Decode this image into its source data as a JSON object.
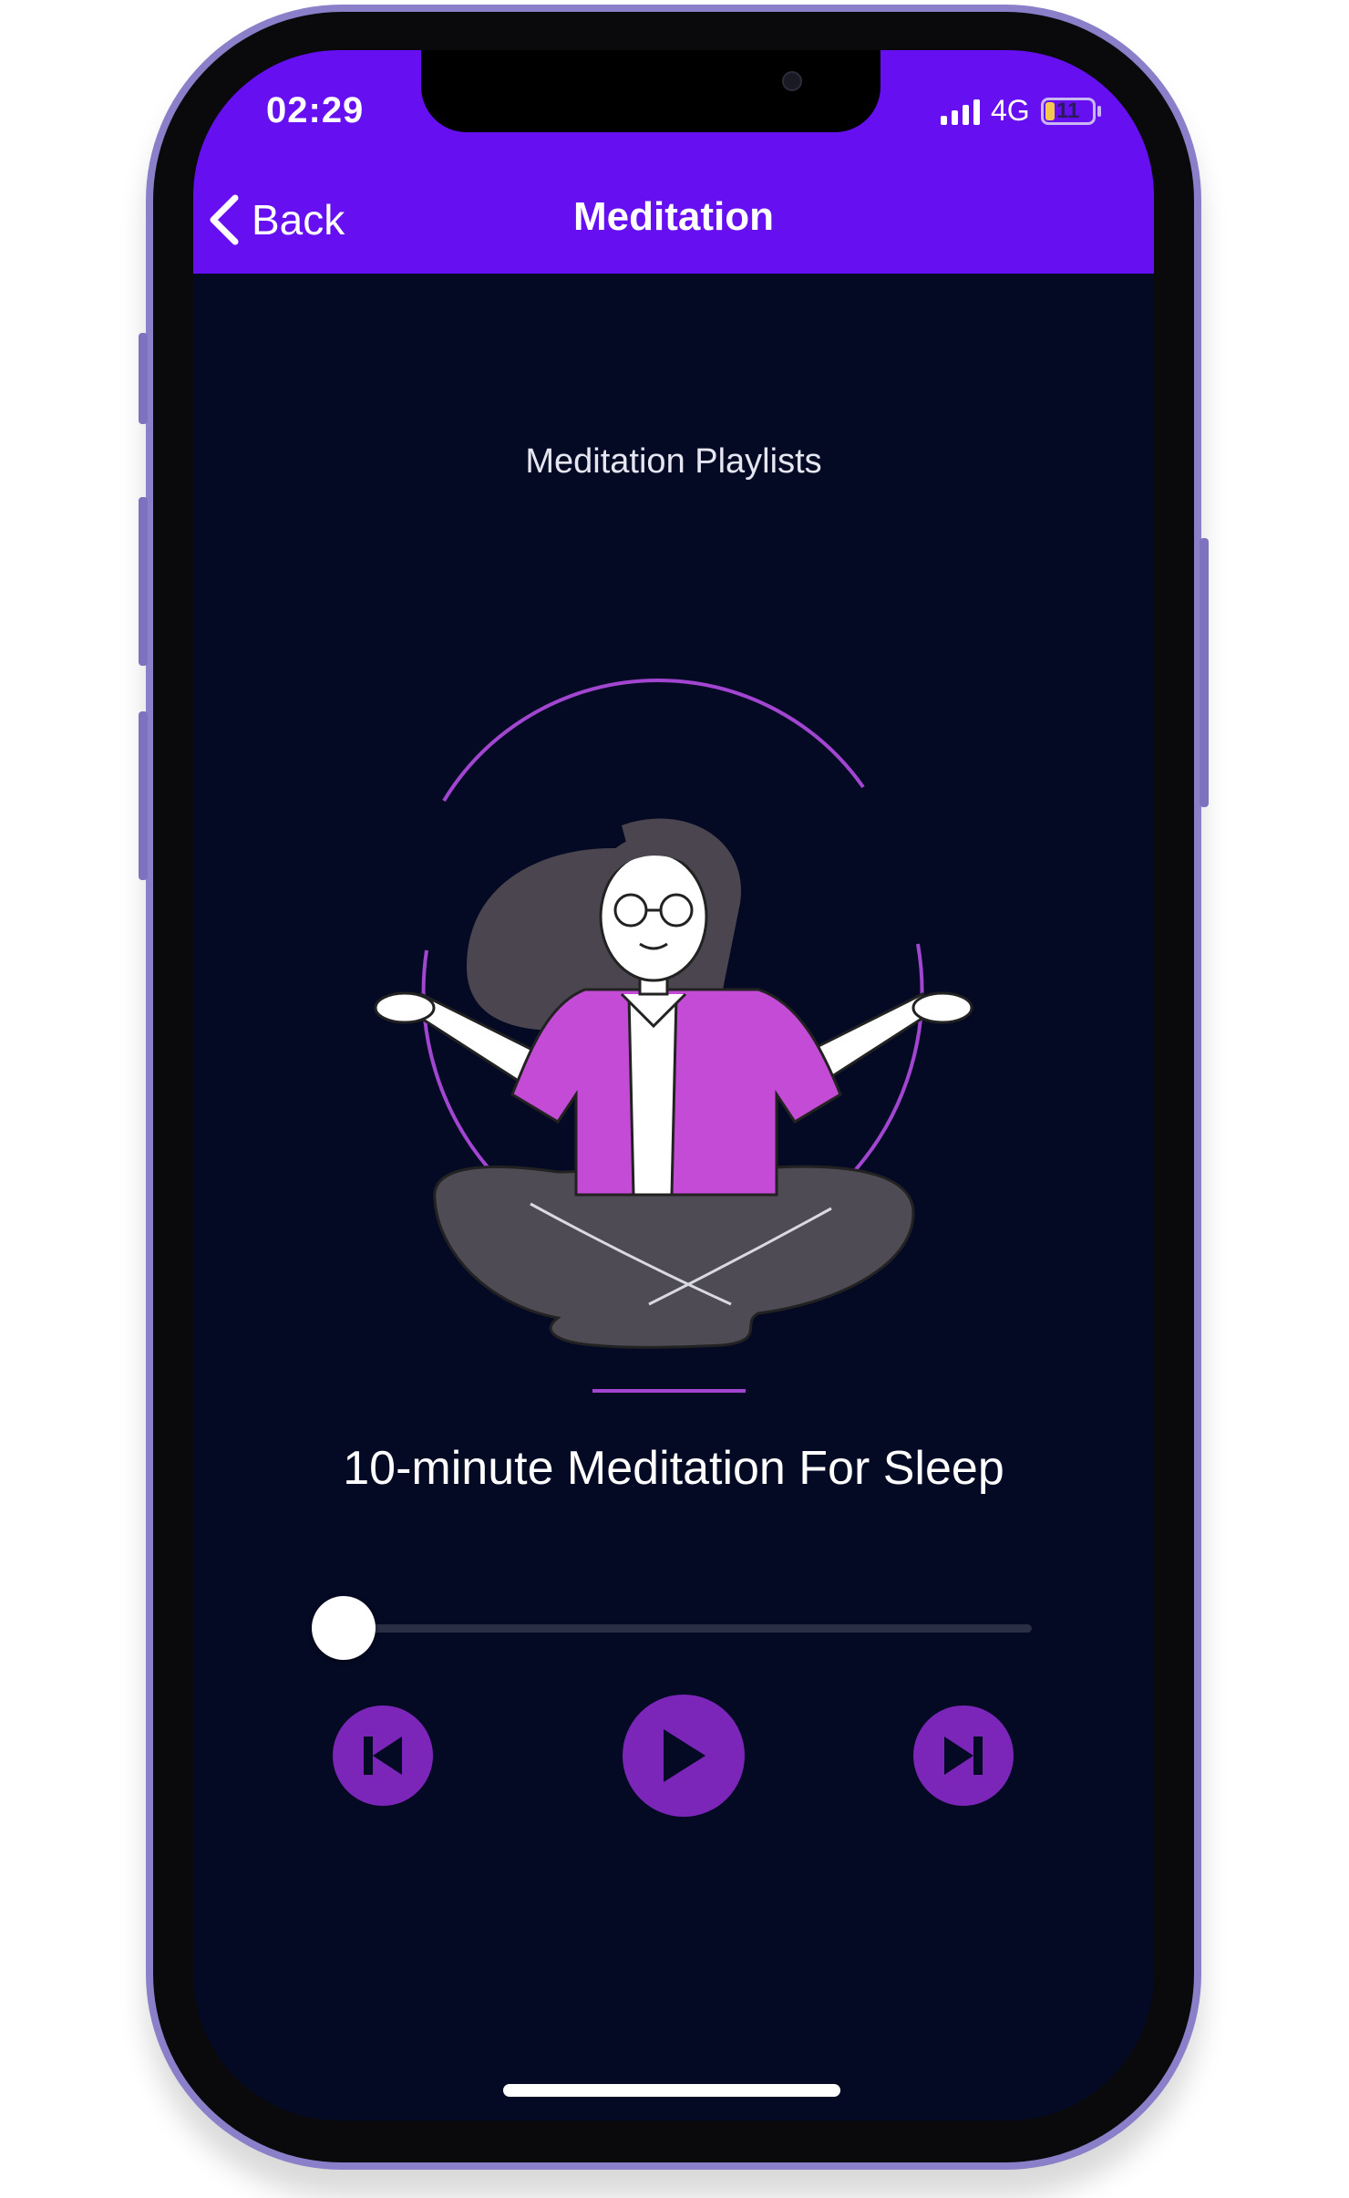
{
  "status_bar": {
    "time": "02:29",
    "network": "4G",
    "battery_level": "11",
    "signal_icon": "cellular-signal-icon",
    "battery_icon": "battery-icon"
  },
  "nav": {
    "back_label": "Back",
    "back_icon": "chevron-left-icon",
    "title": "Meditation"
  },
  "content": {
    "subtitle": "Meditation Playlists",
    "illustration": "meditating-woman-illustration",
    "track_title": "10-minute Meditation For Sleep"
  },
  "player": {
    "progress": 0,
    "buttons": [
      {
        "name": "previous-button",
        "icon": "skip-previous-icon"
      },
      {
        "name": "play-button",
        "icon": "play-icon"
      },
      {
        "name": "next-button",
        "icon": "skip-next-icon"
      }
    ]
  },
  "colors": {
    "header": "#6610f2",
    "background": "#050a24",
    "accent": "#7b26b8",
    "jacket": "#c44bd6"
  }
}
